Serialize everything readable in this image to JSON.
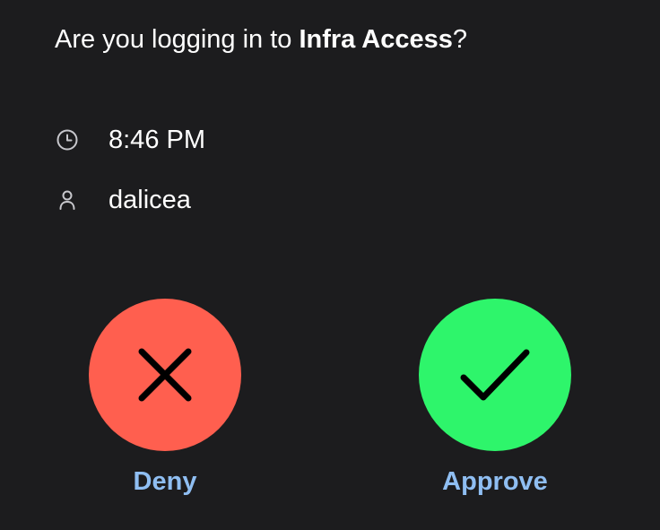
{
  "prompt": {
    "prefix": "Are you logging in to ",
    "app_name": "Infra Access",
    "suffix": "?"
  },
  "details": {
    "time": {
      "icon": "clock-icon",
      "value": "8:46 PM"
    },
    "user": {
      "icon": "person-icon",
      "value": "dalicea"
    }
  },
  "actions": {
    "deny": {
      "label": "Deny",
      "icon": "x-icon",
      "color": "#ff5f4f"
    },
    "approve": {
      "label": "Approve",
      "icon": "checkmark-icon",
      "color": "#2ef56b"
    },
    "label_color": "#8fbef2"
  }
}
